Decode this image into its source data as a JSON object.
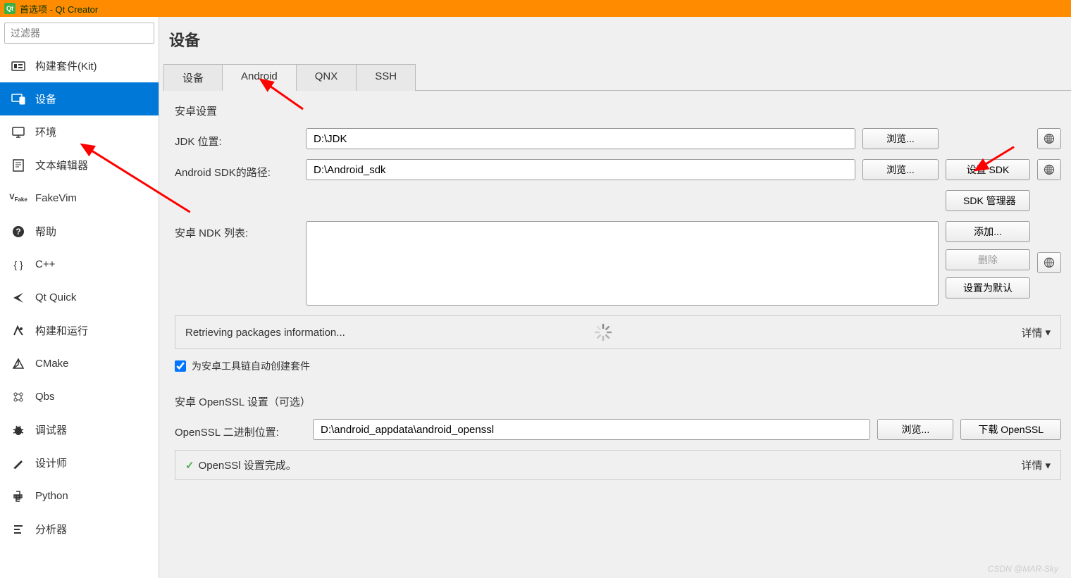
{
  "window": {
    "title": "首选项 - Qt Creator"
  },
  "sidebar": {
    "filter_placeholder": "过滤器",
    "items": [
      {
        "label": "构建套件(Kit)",
        "icon": "kit"
      },
      {
        "label": "设备",
        "icon": "device",
        "selected": true
      },
      {
        "label": "环境",
        "icon": "monitor"
      },
      {
        "label": "文本编辑器",
        "icon": "text"
      },
      {
        "label": "FakeVim",
        "icon": "vim"
      },
      {
        "label": "帮助",
        "icon": "help"
      },
      {
        "label": "C++",
        "icon": "cpp"
      },
      {
        "label": "Qt Quick",
        "icon": "quick"
      },
      {
        "label": "构建和运行",
        "icon": "build"
      },
      {
        "label": "CMake",
        "icon": "cmake"
      },
      {
        "label": "Qbs",
        "icon": "qbs"
      },
      {
        "label": "调试器",
        "icon": "debug"
      },
      {
        "label": "设计师",
        "icon": "design"
      },
      {
        "label": "Python",
        "icon": "python"
      },
      {
        "label": "分析器",
        "icon": "analyze"
      }
    ]
  },
  "content": {
    "title": "设备",
    "tabs": [
      {
        "label": "设备"
      },
      {
        "label": "Android",
        "active": true
      },
      {
        "label": "QNX"
      },
      {
        "label": "SSH"
      }
    ],
    "android": {
      "section_title": "安卓设置",
      "jdk_label": "JDK 位置:",
      "jdk_value": "D:\\JDK",
      "sdk_label": "Android SDK的路径:",
      "sdk_value": "D:\\Android_sdk",
      "ndk_label": "安卓 NDK 列表:",
      "browse_btn": "浏览...",
      "setup_sdk_btn": "设置 SDK",
      "sdk_manager_btn": "SDK 管理器",
      "add_btn": "添加...",
      "remove_btn": "删除",
      "set_default_btn": "设置为默认",
      "status_text": "Retrieving packages information...",
      "details_btn": "详情",
      "auto_kit_checkbox": "为安卓工具链自动创建套件",
      "auto_kit_checked": true
    },
    "openssl": {
      "section_title": "安卓 OpenSSL 设置（可选）",
      "location_label": "OpenSSL 二进制位置:",
      "location_value": "D:\\android_appdata\\android_openssl",
      "browse_btn": "浏览...",
      "download_btn": "下载 OpenSSL",
      "status_text": "OpenSSl 设置完成。",
      "details_btn": "详情"
    }
  },
  "watermark": "CSDN @MAR-Sky"
}
